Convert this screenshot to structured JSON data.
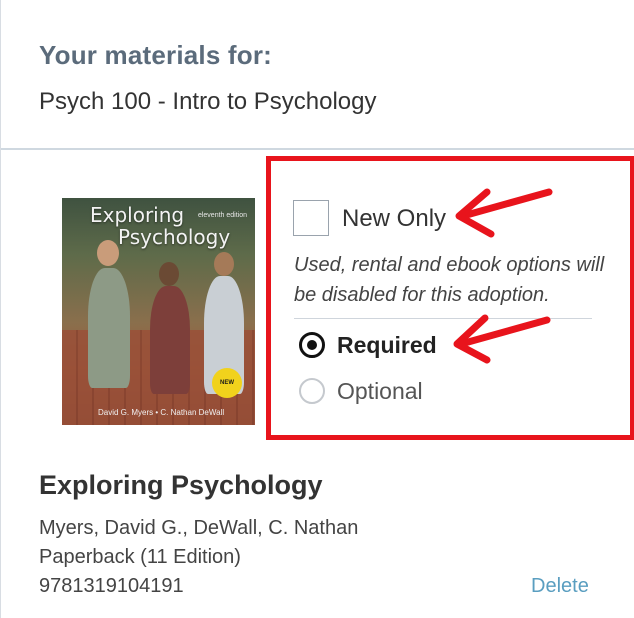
{
  "header": {
    "title": "Your materials for:",
    "course": "Psych 100 - Intro to Psychology"
  },
  "book": {
    "cover": {
      "title_line1": "Exploring",
      "title_line2": "Psychology",
      "edition": "eleventh edition",
      "authors": "David G. Myers • C. Nathan DeWall",
      "badge": "NEW"
    },
    "title": "Exploring Psychology",
    "authors": "Myers, David G., DeWall, C. Nathan",
    "format": "Paperback (11 Edition)",
    "isbn": "9781319104191",
    "delete_label": "Delete"
  },
  "options": {
    "new_only_label": "New Only",
    "new_only_checked": false,
    "help_text": "Used, rental and ebook options will be disabled for this adoption.",
    "requirement": [
      {
        "label": "Required",
        "selected": true
      },
      {
        "label": "Optional",
        "selected": false
      }
    ]
  },
  "colors": {
    "highlight": "#e8141c",
    "link": "#5a9ec0",
    "heading": "#5b6b7b"
  }
}
